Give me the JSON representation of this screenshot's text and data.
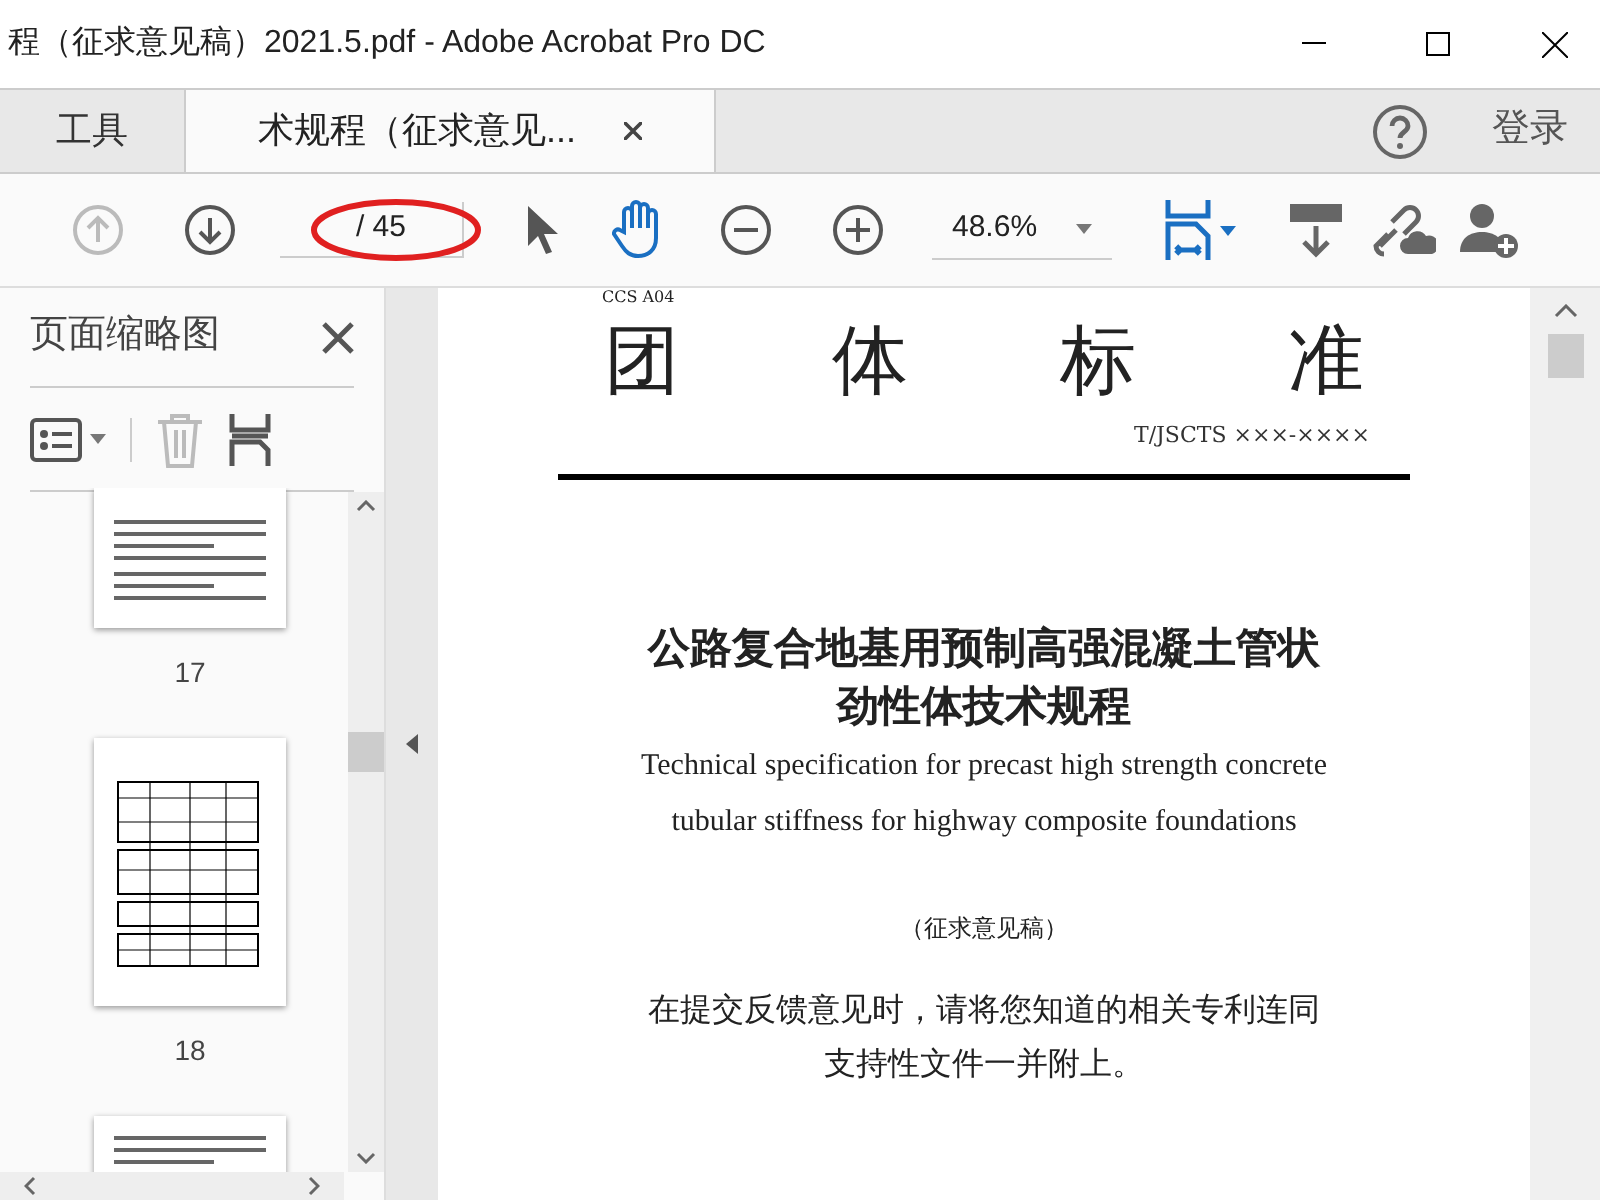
{
  "window": {
    "title": "程（征求意见稿）2021.5.pdf - Adobe Acrobat Pro DC"
  },
  "tabs": [
    {
      "label": "工具",
      "selected": false
    },
    {
      "label": "术规程（征求意见...",
      "selected": true,
      "closable": true
    }
  ],
  "header": {
    "sign_in": "登录"
  },
  "toolbar": {
    "page_field": {
      "total": "/ 45"
    },
    "zoom": "48.6%",
    "up_disabled": true
  },
  "sidebar": {
    "title": "页面缩略图",
    "thumbnails": [
      {
        "page": "17",
        "kind": "text"
      },
      {
        "page": "18",
        "kind": "table"
      },
      {
        "kind": "text"
      }
    ]
  },
  "document": {
    "code": "CCS A04",
    "heading": "团　　体　　标　　准",
    "number": "T/JSCTS ×××-××××",
    "title_lines": [
      "公路复合地基用预制高强混凝土管状",
      "劲性体技术规程"
    ],
    "english_lines": [
      "Technical specification for precast high strength concrete",
      "tubular stiffness for highway composite foundations"
    ],
    "status": "（征求意见稿）",
    "note_lines": [
      "在提交反馈意见时，请将您知道的相关专利连同",
      "支持性文件一并附上。"
    ]
  }
}
